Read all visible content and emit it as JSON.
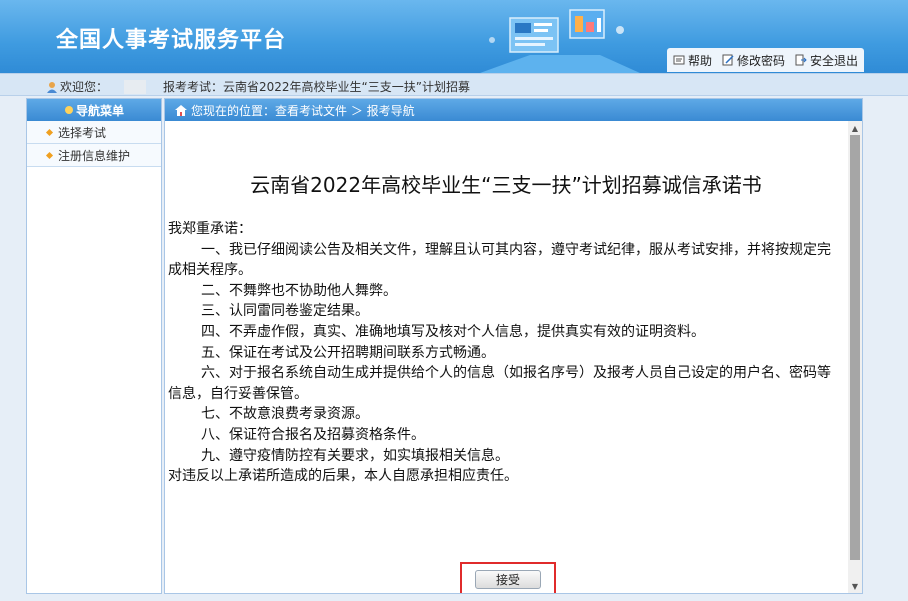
{
  "header": {
    "title": "全国人事考试服务平台",
    "links": [
      {
        "label": "帮助",
        "icon": "help-icon"
      },
      {
        "label": "修改密码",
        "icon": "edit-password-icon"
      },
      {
        "label": "安全退出",
        "icon": "logout-icon"
      }
    ]
  },
  "infobar": {
    "welcome": "欢迎您：",
    "exam": "报考考试：云南省2022年高校毕业生“三支一扶”计划招募"
  },
  "sidebar": {
    "heading": "导航菜单",
    "items": [
      {
        "label": "选择考试"
      },
      {
        "label": "注册信息维护"
      }
    ]
  },
  "breadcrumb": "您现在的位置：查看考试文件 ＞ 报考导航",
  "document": {
    "title": "云南省2022年高校毕业生“三支一扶”计划招募诚信承诺书",
    "intro": "我郑重承诺：",
    "items": [
      "一、我已仔细阅读公告及相关文件，理解且认可其内容，遵守考试纪律，服从考试安排，并将按规定完成相关程序。",
      "二、不舞弊也不协助他人舞弊。",
      "三、认同雷同卷鉴定结果。",
      "四、不弄虚作假，真实、准确地填写及核对个人信息，提供真实有效的证明资料。",
      "五、保证在考试及公开招聘期间联系方式畅通。",
      "六、对于报名系统自动生成并提供给个人的信息（如报名序号）及报考人员自己设定的用户名、密码等信息，自行妥善保管。",
      "七、不故意浪费考录资源。",
      "八、保证符合报名及招募资格条件。",
      "九、遵守疫情防控有关要求，如实填报相关信息。"
    ],
    "closing": "对违反以上承诺所造成的后果，本人自愿承担相应责任。"
  },
  "accept_button": "接受",
  "colors": {
    "header_blue": "#3f9be0",
    "highlight_red": "#e02b2b"
  }
}
